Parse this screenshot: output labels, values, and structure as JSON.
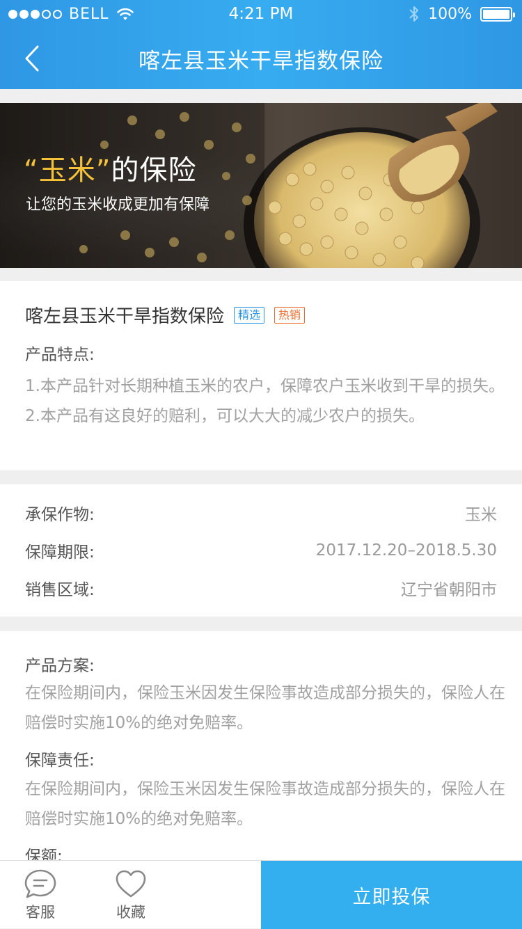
{
  "status_bar": {
    "carrier": "BELL",
    "time": "4:21 PM",
    "battery": "100%",
    "signal_bars_filled": 3,
    "signal_bars_total": 5
  },
  "nav": {
    "title": "喀左县玉米干旱指数保险",
    "back_icon": "chevron-left-icon"
  },
  "banner": {
    "title_open_quote": "“",
    "title_highlight": "玉米",
    "title_close_quote": "”",
    "title_rest": "的保险",
    "subtitle": "让您的玉米收成更加有保障",
    "highlight_color": "#f6c23a"
  },
  "product": {
    "name": "喀左县玉米干旱指数保险",
    "tags": [
      {
        "label": "精选",
        "color": "#2f97e4"
      },
      {
        "label": "热销",
        "color": "#ef6b2d"
      }
    ],
    "features_label": "产品特点:",
    "features_line1": "1.本产品针对长期种植玉米的农户，保障农户玉米收到干旱的损失。",
    "features_line2": "2.本产品有这良好的赔利，可以大大的减少农户的损失。"
  },
  "info": {
    "rows": [
      {
        "key": "承保作物:",
        "value": "玉米"
      },
      {
        "key": "保障期限:",
        "value": "2017.12.20–2018.5.30"
      },
      {
        "key": "销售区域:",
        "value": "辽宁省朝阳市"
      }
    ]
  },
  "plan": {
    "scheme_label": "产品方案:",
    "scheme_text": "在保险期间内，保险玉米因发生保险事故造成部分损失的，保险人在赔偿时实施10%的绝对免赔率。",
    "liability_label": "保障责任:",
    "liability_text": "在保险期间内，保险玉米因发生保险事故造成部分损失的，保险人在赔偿时实施10%的绝对免赔率。",
    "amount_label": "保额:"
  },
  "bottom_bar": {
    "service_label": "客服",
    "service_icon": "chat-bubble-icon",
    "favorite_label": "收藏",
    "favorite_icon": "heart-icon",
    "buy_label": "立即投保",
    "accent_color": "#33aff0"
  }
}
